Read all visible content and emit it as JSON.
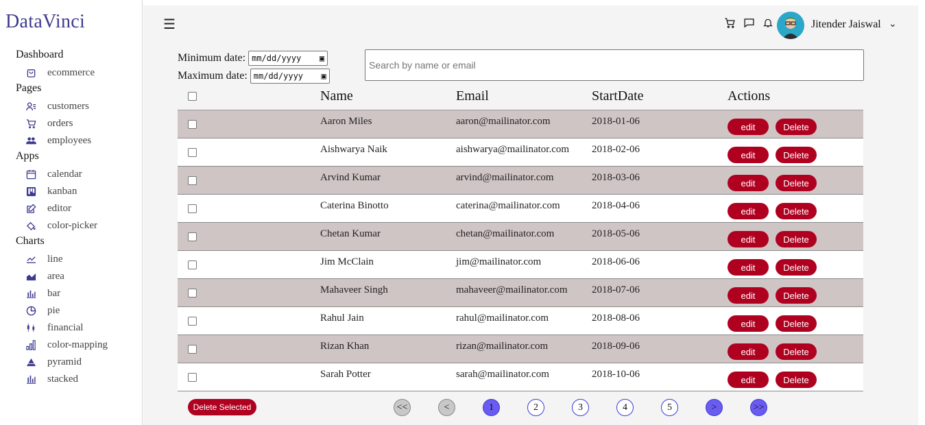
{
  "app": {
    "logo": "DataVinci"
  },
  "sidebar": {
    "sections": [
      {
        "title": "Dashboard",
        "items": [
          {
            "label": "ecommerce",
            "icon": "shopping-bag-icon"
          }
        ]
      },
      {
        "title": "Pages",
        "items": [
          {
            "label": "customers",
            "icon": "users-icon"
          },
          {
            "label": "orders",
            "icon": "cart-icon"
          },
          {
            "label": "employees",
            "icon": "team-icon"
          }
        ]
      },
      {
        "title": "Apps",
        "items": [
          {
            "label": "calendar",
            "icon": "calendar-icon"
          },
          {
            "label": "kanban",
            "icon": "kanban-icon"
          },
          {
            "label": "editor",
            "icon": "edit-icon"
          },
          {
            "label": "color-picker",
            "icon": "paint-bucket-icon"
          }
        ]
      },
      {
        "title": "Charts",
        "items": [
          {
            "label": "line",
            "icon": "line-chart-icon"
          },
          {
            "label": "area",
            "icon": "area-chart-icon"
          },
          {
            "label": "bar",
            "icon": "bar-chart-icon"
          },
          {
            "label": "pie",
            "icon": "pie-chart-icon"
          },
          {
            "label": "financial",
            "icon": "candlestick-icon"
          },
          {
            "label": "color-mapping",
            "icon": "bars-ascending-icon"
          },
          {
            "label": "pyramid",
            "icon": "pyramid-icon"
          },
          {
            "label": "stacked",
            "icon": "stacked-bar-icon"
          }
        ]
      }
    ]
  },
  "header": {
    "user_name": "Jitender Jaiswal"
  },
  "filters": {
    "min_label": "Minimum date:",
    "max_label": "Maximum date:",
    "date_placeholder": "mm/dd/yyyy",
    "search_placeholder": "Search by name or email"
  },
  "table": {
    "columns": [
      "Name",
      "Email",
      "StartDate",
      "Actions"
    ],
    "edit_label": "edit",
    "delete_label": "Delete",
    "rows": [
      {
        "name": "Aaron Miles",
        "email": "aaron@mailinator.com",
        "start": "2018-01-06"
      },
      {
        "name": "Aishwarya Naik",
        "email": "aishwarya@mailinator.com",
        "start": "2018-02-06"
      },
      {
        "name": "Arvind Kumar",
        "email": "arvind@mailinator.com",
        "start": "2018-03-06"
      },
      {
        "name": "Caterina Binotto",
        "email": "caterina@mailinator.com",
        "start": "2018-04-06"
      },
      {
        "name": "Chetan Kumar",
        "email": "chetan@mailinator.com",
        "start": "2018-05-06"
      },
      {
        "name": "Jim McClain",
        "email": "jim@mailinator.com",
        "start": "2018-06-06"
      },
      {
        "name": "Mahaveer Singh",
        "email": "mahaveer@mailinator.com",
        "start": "2018-07-06"
      },
      {
        "name": "Rahul Jain",
        "email": "rahul@mailinator.com",
        "start": "2018-08-06"
      },
      {
        "name": "Rizan Khan",
        "email": "rizan@mailinator.com",
        "start": "2018-09-06"
      },
      {
        "name": "Sarah Potter",
        "email": "sarah@mailinator.com",
        "start": "2018-10-06"
      }
    ]
  },
  "footer": {
    "delete_selected": "Delete Selected",
    "pager": [
      {
        "label": "<<",
        "style": "grey"
      },
      {
        "label": "<",
        "style": "grey"
      },
      {
        "label": "1",
        "style": "purple"
      },
      {
        "label": "2",
        "style": "white"
      },
      {
        "label": "3",
        "style": "white"
      },
      {
        "label": "4",
        "style": "white"
      },
      {
        "label": "5",
        "style": "white"
      },
      {
        "label": ">",
        "style": "purple"
      },
      {
        "label": ">>",
        "style": "purple"
      }
    ]
  },
  "colors": {
    "accent": "#3d3a8f",
    "danger": "#b00020",
    "row_shade": "#d0c5c5",
    "page_active": "#6a5cf0"
  }
}
